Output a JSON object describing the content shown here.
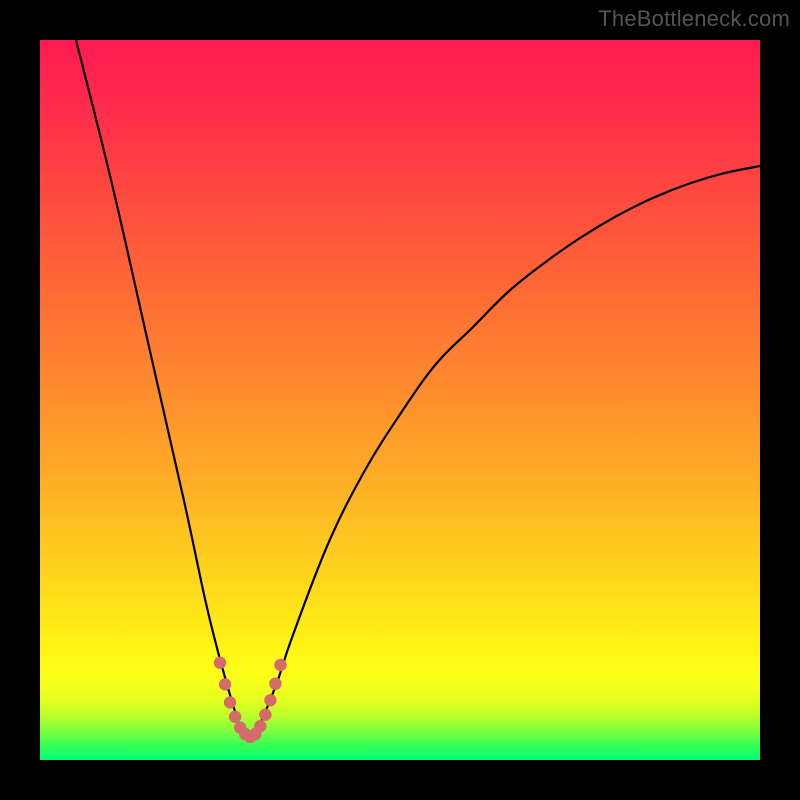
{
  "watermark": "TheBottleneck.com",
  "colors": {
    "page_bg": "#000000",
    "watermark_text": "#555555",
    "curve_stroke": "#000000",
    "marker_stroke": "#d56a6a",
    "marker_fill": "#d56a6a"
  },
  "chart_data": {
    "type": "line",
    "title": "",
    "xlabel": "",
    "ylabel": "",
    "xlim": [
      0,
      100
    ],
    "ylim": [
      0,
      100
    ],
    "grid": false,
    "legend": false,
    "note": "No axis ticks or numeric labels are shown; values are read in percent-of-plot coordinates (0 = left/bottom, 100 = right/top). Curve is a V-shaped profile with minimum near x≈29.",
    "series": [
      {
        "name": "bottleneck-curve",
        "x": [
          5,
          10,
          15,
          20,
          23,
          25,
          27,
          28,
          29,
          30,
          31,
          33,
          35,
          40,
          45,
          50,
          55,
          60,
          65,
          70,
          75,
          80,
          85,
          90,
          95,
          100
        ],
        "y": [
          100,
          80,
          58,
          36,
          22,
          14,
          7,
          4,
          3,
          4,
          6,
          11,
          17,
          30,
          40,
          48,
          55,
          60,
          65,
          69,
          72.5,
          75.5,
          78,
          80,
          81.5,
          82.5
        ]
      }
    ],
    "markers": {
      "name": "highlight-dots",
      "note": "Salmon dotted segment around the minimum of the curve.",
      "x": [
        25.0,
        25.7,
        26.4,
        27.1,
        27.8,
        28.5,
        29.2,
        29.9,
        30.6,
        31.3,
        32.0,
        32.7,
        33.4
      ],
      "y": [
        13.5,
        10.5,
        8.0,
        6.0,
        4.5,
        3.6,
        3.2,
        3.6,
        4.7,
        6.3,
        8.3,
        10.6,
        13.2
      ]
    }
  }
}
